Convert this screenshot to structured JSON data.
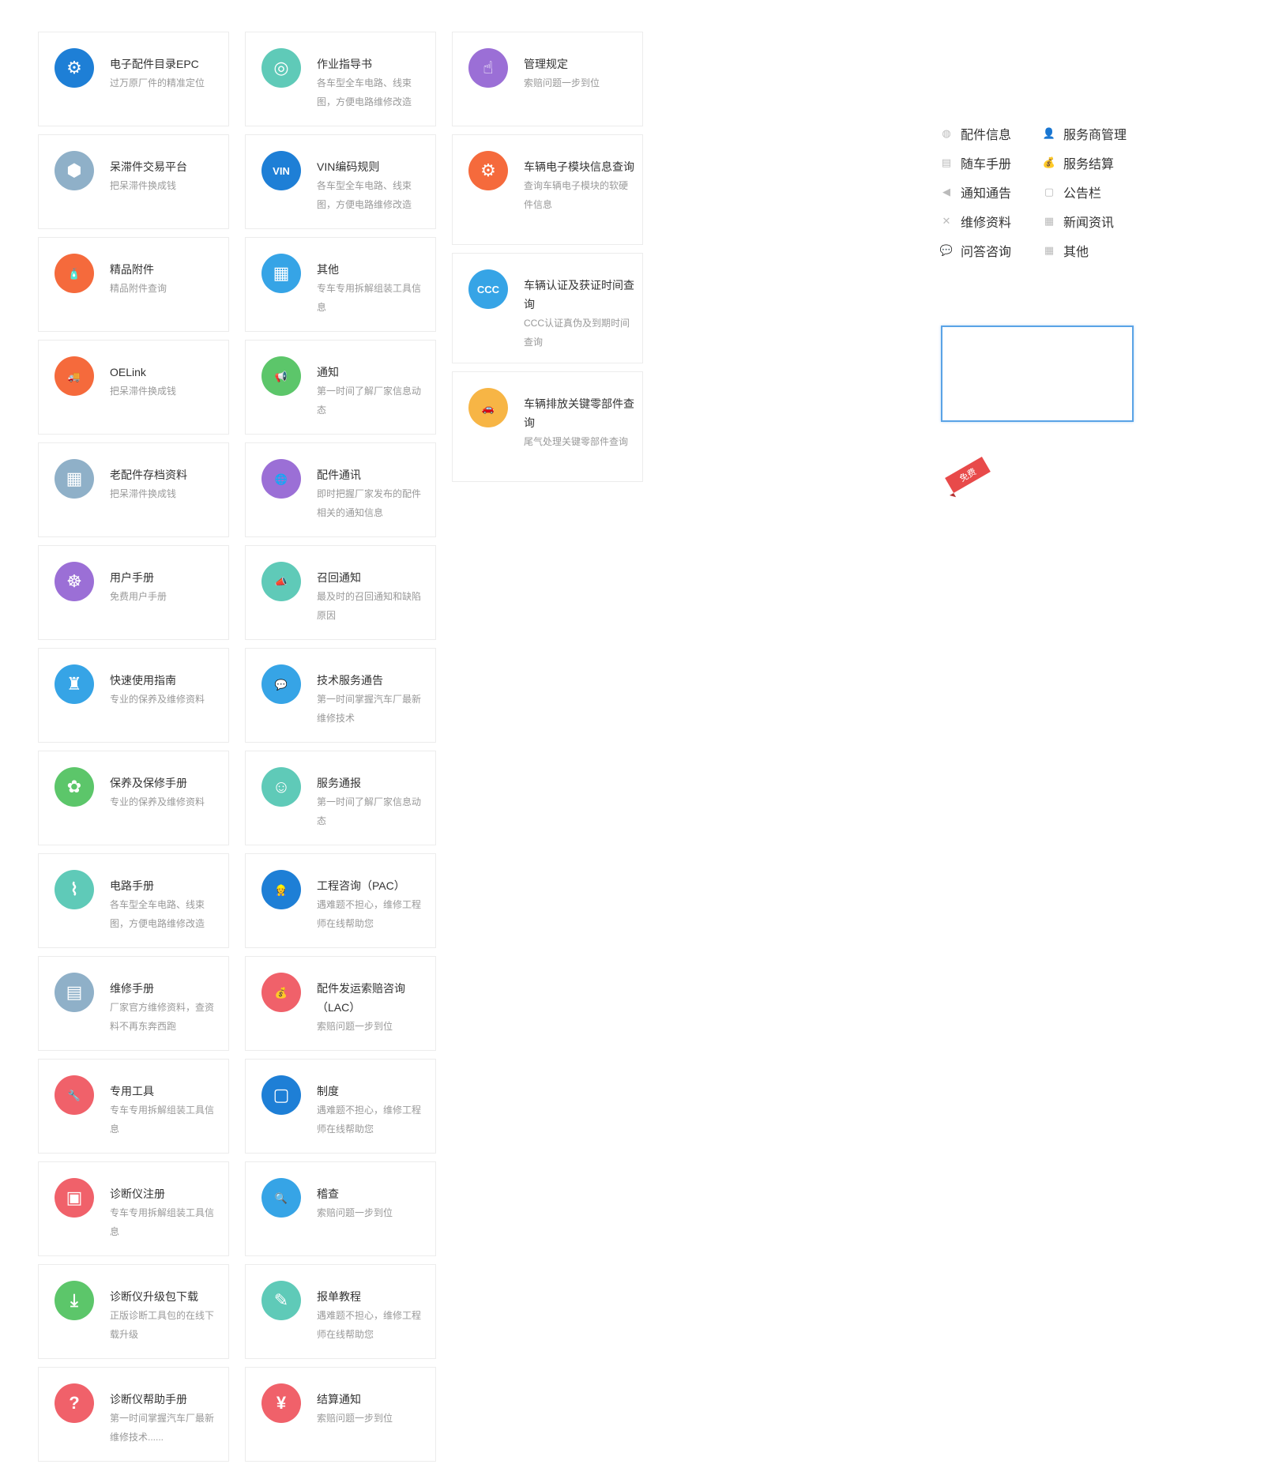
{
  "cards_col_a": [
    {
      "title": "电子配件目录EPC",
      "desc": "过万原厂件的精准定位",
      "color": "#1e7fd6",
      "glyph": "⚙",
      "icon": "gear-search-icon",
      "tall": false
    },
    {
      "title": "呆滞件交易平台",
      "desc": "把呆滞件换成钱",
      "color": "#8fb0c8",
      "glyph": "⬢",
      "icon": "box-icon",
      "tall": false
    },
    {
      "title": "精品附件",
      "desc": "精品附件查询",
      "color": "#f56a3c",
      "glyph": "🧴",
      "icon": "bottle-icon",
      "tall": false
    },
    {
      "title": "OELink",
      "desc": "把呆滞件换成钱",
      "color": "#f56a3c",
      "glyph": "🚚",
      "icon": "truck-icon",
      "tall": false
    },
    {
      "title": "老配件存档资料",
      "desc": "把呆滞件换成钱",
      "color": "#8fb0c8",
      "glyph": "▦",
      "icon": "archive-icon",
      "tall": false
    },
    {
      "title": "用户手册",
      "desc": "免费用户手册",
      "color": "#9b6fd6",
      "glyph": "☸",
      "icon": "user-gear-icon",
      "tall": false
    },
    {
      "title": "快速使用指南",
      "desc": "专业的保养及维修资料",
      "color": "#36a4e6",
      "glyph": "♜",
      "icon": "joystick-icon",
      "tall": false
    },
    {
      "title": "保养及保修手册",
      "desc": "专业的保养及维修资料",
      "color": "#5cc66a",
      "glyph": "✿",
      "icon": "plant-hand-icon",
      "tall": false
    },
    {
      "title": "电路手册",
      "desc": "各车型全车电路、线束图，方便电路维修改造",
      "color": "#5fcab8",
      "glyph": "⌇",
      "icon": "circuit-icon",
      "tall": false
    },
    {
      "title": " 维修手册",
      "desc": "厂家官方维修资料，查资料不再东奔西跑",
      "color": "#8fb0c8",
      "glyph": "▤",
      "icon": "manual-icon",
      "tall": false
    },
    {
      "title": "专用工具",
      "desc": "专车专用拆解组装工具信息",
      "color": "#f0616a",
      "glyph": "🔧",
      "icon": "wrench-icon",
      "tall": false
    },
    {
      "title": "诊断仪注册",
      "desc": "专车专用拆解组装工具信息",
      "color": "#f0616a",
      "glyph": "▣",
      "icon": "monitor-user-icon",
      "tall": false
    },
    {
      "title": "诊断仪升级包下载",
      "desc": "正版诊断工具包的在线下载升级",
      "color": "#5cc66a",
      "glyph": "⤓",
      "icon": "monitor-download-icon",
      "tall": false
    },
    {
      "title": "诊断仪帮助手册",
      "desc": "第一时间掌握汽车厂最新维修技术......",
      "color": "#f0616a",
      "glyph": "?",
      "icon": "monitor-help-icon",
      "tall": false
    }
  ],
  "cards_col_b": [
    {
      "title": "作业指导书",
      "desc": "各车型全车电路、线束图，方便电路维修改造",
      "color": "#5fcab8",
      "glyph": "◎",
      "icon": "steering-wheel-icon",
      "tall": false
    },
    {
      "title": "VIN编码规则",
      "desc": "各车型全车电路、线束图，方便电路维修改造",
      "color": "#1e7fd6",
      "glyph": "VIN",
      "icon": "vin-icon",
      "tall": false
    },
    {
      "title": "其他",
      "desc": "专车专用拆解组装工具信息",
      "color": "#36a4e6",
      "glyph": "▦",
      "icon": "grid-icon",
      "tall": false
    },
    {
      "title": "通知",
      "desc": "第一时间了解厂家信息动态",
      "color": "#5cc66a",
      "glyph": "📢",
      "icon": "person-megaphone-icon",
      "tall": false
    },
    {
      "title": "配件通讯",
      "desc": "即时把握厂家发布的配件相关的通知信息",
      "color": "#9b6fd6",
      "glyph": "🌐",
      "icon": "person-globe-icon",
      "tall": false
    },
    {
      "title": "召回通知",
      "desc": "最及时的召回通知和缺陷原因",
      "color": "#5fcab8",
      "glyph": "📣",
      "icon": "megaphone-icon",
      "tall": false
    },
    {
      "title": "技术服务通告",
      "desc": "第一时间掌握汽车厂最新维修技术",
      "color": "#36a4e6",
      "glyph": "💬",
      "icon": "chat-icon",
      "tall": false
    },
    {
      "title": "服务通报",
      "desc": "第一时间了解厂家信息动态",
      "color": "#5fcab8",
      "glyph": "☺",
      "icon": "service-person-icon",
      "tall": false
    },
    {
      "title": "工程咨询（PAC）",
      "desc": "遇难题不担心，维修工程师在线帮助您",
      "color": "#1e7fd6",
      "glyph": "👷",
      "icon": "engineer-icon",
      "tall": false
    },
    {
      "title": "配件发运索赔咨询（LAC）",
      "desc": "索赔问题一步到位",
      "color": "#f0616a",
      "glyph": "💰",
      "icon": "money-hand-icon",
      "tall": false
    },
    {
      "title": "制度",
      "desc": "遇难题不担心，维修工程师在线帮助您",
      "color": "#1e7fd6",
      "glyph": "▢",
      "icon": "document-shield-icon",
      "tall": false
    },
    {
      "title": "稽查",
      "desc": "索赔问题一步到位",
      "color": "#36a4e6",
      "glyph": "🔍",
      "icon": "magnifier-icon",
      "tall": false
    },
    {
      "title": "报单教程",
      "desc": "遇难题不担心，维修工程师在线帮助您",
      "color": "#5fcab8",
      "glyph": "✎",
      "icon": "edit-document-icon",
      "tall": false
    },
    {
      "title": "结算通知",
      "desc": "索赔问题一步到位",
      "color": "#f0616a",
      "glyph": "¥",
      "icon": "money-bag-icon",
      "tall": false
    }
  ],
  "cards_col_c": [
    {
      "title": "管理规定",
      "desc": "索赔问题一步到位",
      "color": "#9b6fd6",
      "glyph": "☝",
      "icon": "hand-pointer-icon",
      "tall": false
    },
    {
      "title": "车辆电子模块信息查询",
      "desc": "查询车辆电子模块的软硬件信息",
      "color": "#f56a3c",
      "glyph": "⚙",
      "icon": "browser-gear-icon",
      "tall": true
    },
    {
      "title": "车辆认证及获证时间查询",
      "desc": "CCC认证真伪及到期时间查询",
      "color": "#36a4e6",
      "glyph": "CCC",
      "icon": "ccc-icon",
      "tall": true
    },
    {
      "title": "车辆排放关键零部件查询",
      "desc": "尾气处理关键零部件查询",
      "color": "#f7b545",
      "glyph": "🚗",
      "icon": "car-icon",
      "tall": true
    }
  ],
  "sidebar": {
    "items": [
      {
        "label": "配件信息",
        "icon": "parts-icon",
        "glyph": "◍"
      },
      {
        "label": "服务商管理",
        "icon": "user-icon",
        "glyph": "👤"
      },
      {
        "label": "随车手册",
        "icon": "book-icon",
        "glyph": "▤"
      },
      {
        "label": "服务结算",
        "icon": "money-bag-icon",
        "glyph": "💰"
      },
      {
        "label": "通知通告",
        "icon": "megaphone-icon",
        "glyph": "◀"
      },
      {
        "label": "公告栏",
        "icon": "briefcase-icon",
        "glyph": "▢"
      },
      {
        "label": "维修资料",
        "icon": "tools-icon",
        "glyph": "✕"
      },
      {
        "label": "新闻资讯",
        "icon": "news-icon",
        "glyph": "▦"
      },
      {
        "label": "问答咨询",
        "icon": "chat-icon",
        "glyph": "💬"
      },
      {
        "label": "其他",
        "icon": "grid-icon",
        "glyph": "▦"
      }
    ],
    "ribbon_label": "免费"
  }
}
